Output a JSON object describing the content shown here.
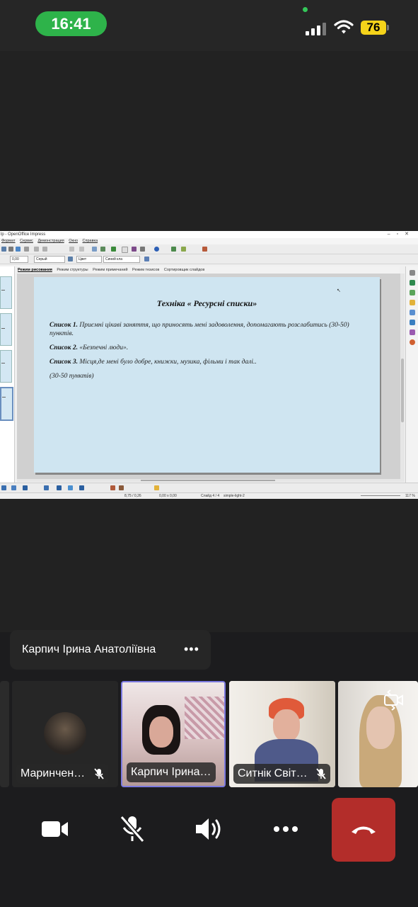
{
  "status_bar": {
    "time": "16:41",
    "battery": "76"
  },
  "shared_screen": {
    "window_title": "lp - OpenOffice Impress",
    "menu": [
      "Формат",
      "Сервис",
      "Демонстрация",
      "Окно",
      "Справка"
    ],
    "toolbar": {
      "line_width": "0,00",
      "line_color": "Серый",
      "area_style": "Цвет",
      "area_color": "Синий кла"
    },
    "view_tabs": [
      "Режим рисования",
      "Режим структуры",
      "Режим примечаний",
      "Режим тезисов",
      "Сортировщик слайдов"
    ],
    "slide": {
      "title": "Техніка « Ресурсні списки»",
      "items": [
        {
          "label": "Список 1.",
          "text": " Приємні цікаві заняття, що приносять мені задоволення, допомагають розслабитись (30-50) пунктів."
        },
        {
          "label": "Список 2.",
          "text": " «Безпечні люди»."
        },
        {
          "label": "Список 3.",
          "text": " Місця,де мені було добре, книжки, музика, фільми і так далі.."
        }
      ],
      "footer": "(30-50 пунктів)"
    },
    "status": {
      "position": "8,75 / 0,26",
      "size": "0,00 x 0,00",
      "slide": "Слайд 4 / 4",
      "layout": "simple-light-2",
      "zoom": "117 %"
    }
  },
  "speaker": {
    "name": "Карпич Ірина Анатоліївна"
  },
  "participants": [
    {
      "name": "Маринчен…",
      "muted": true
    },
    {
      "name": "Карпич Ірина…",
      "muted": false
    },
    {
      "name": "Ситнік Світ…",
      "muted": true
    }
  ]
}
